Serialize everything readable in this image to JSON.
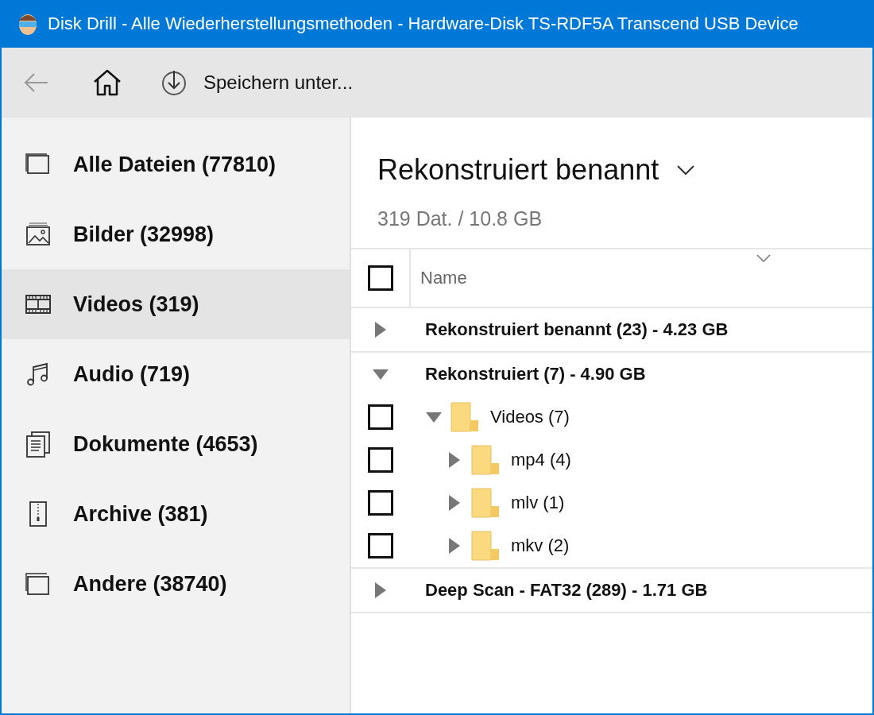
{
  "window": {
    "title": "Disk Drill - Alle Wiederherstellungsmethoden - Hardware-Disk TS-RDF5A Transcend USB Device"
  },
  "toolbar": {
    "back_disabled": true,
    "save_label": "Speichern unter..."
  },
  "sidebar": {
    "items": [
      {
        "label": "Alle Dateien (77810)",
        "kind": "all",
        "selected": false
      },
      {
        "label": "Bilder (32998)",
        "kind": "images",
        "selected": false
      },
      {
        "label": "Videos (319)",
        "kind": "videos",
        "selected": true
      },
      {
        "label": "Audio (719)",
        "kind": "audio",
        "selected": false
      },
      {
        "label": "Dokumente (4653)",
        "kind": "documents",
        "selected": false
      },
      {
        "label": "Archive (381)",
        "kind": "archives",
        "selected": false
      },
      {
        "label": "Andere (38740)",
        "kind": "other",
        "selected": false
      }
    ]
  },
  "main": {
    "title": "Rekonstruiert benannt",
    "subtitle": "319 Dat. / 10.8 GB"
  },
  "table": {
    "columns": [
      {
        "label": "Name"
      }
    ],
    "header_checked": false,
    "groups": [
      {
        "label": "Rekonstruiert benannt (23) - 4.23 GB",
        "expanded": false
      },
      {
        "label": "Rekonstruiert (7) - 4.90 GB",
        "expanded": true,
        "children": [
          {
            "label": "Videos (7)",
            "expanded": true,
            "checked": false,
            "children": [
              {
                "label": "mp4 (4)",
                "expanded": false,
                "checked": false
              },
              {
                "label": "mlv (1)",
                "expanded": false,
                "checked": false
              },
              {
                "label": "mkv (2)",
                "expanded": false,
                "checked": false
              }
            ]
          }
        ]
      },
      {
        "label": "Deep Scan - FAT32 (289) - 1.71 GB",
        "expanded": false
      }
    ]
  }
}
